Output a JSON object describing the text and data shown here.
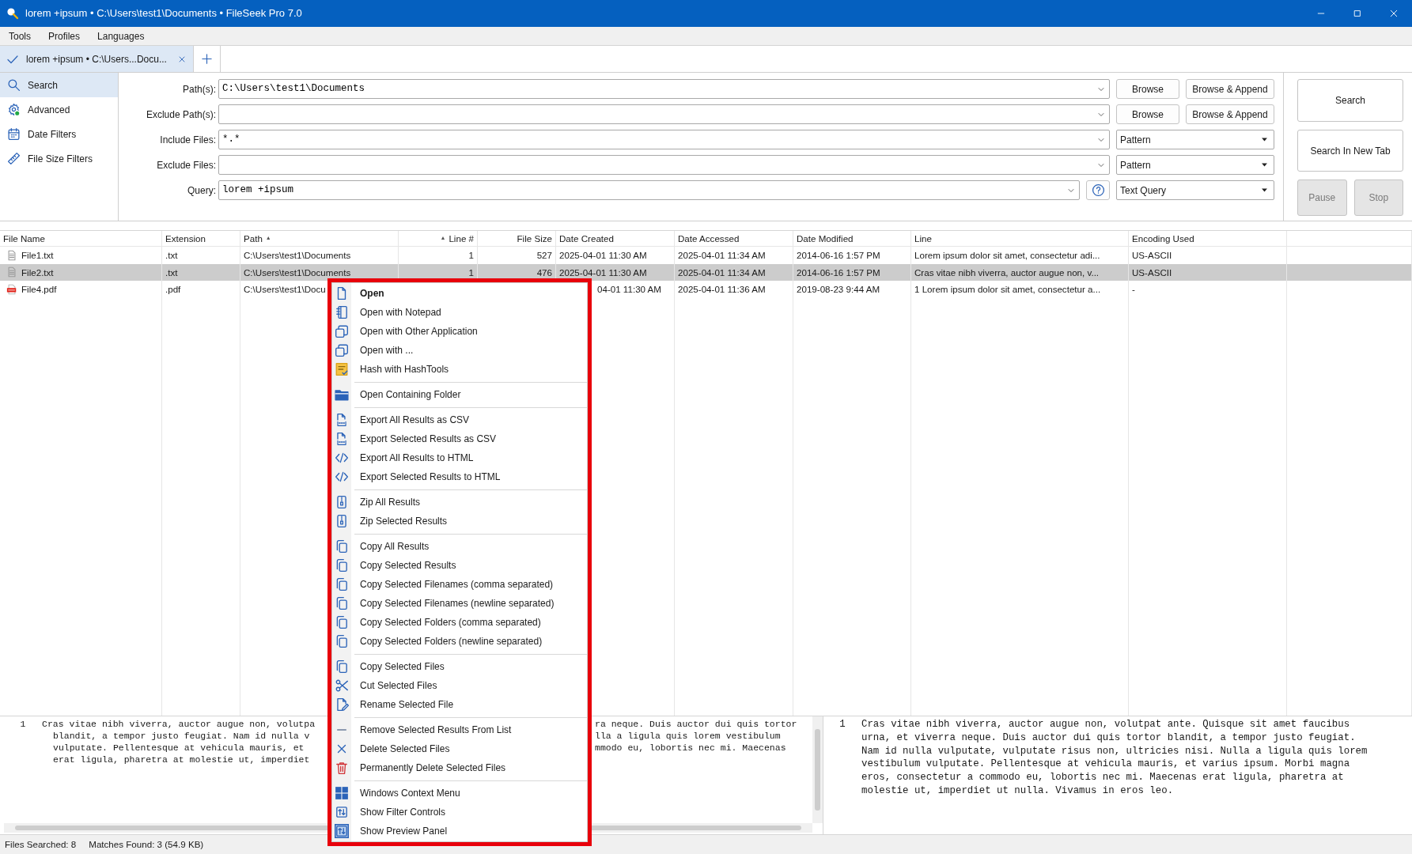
{
  "window": {
    "title": "lorem +ipsum • C:\\Users\\test1\\Documents • FileSeek Pro 7.0"
  },
  "menu_bar": [
    "Tools",
    "Profiles",
    "Languages"
  ],
  "tabs": [
    {
      "label": "lorem +ipsum • C:\\Users...Docu...",
      "selected": true
    }
  ],
  "sidebar": {
    "items": [
      {
        "label": "Search",
        "selected": true
      },
      {
        "label": "Advanced",
        "selected": false
      },
      {
        "label": "Date Filters",
        "selected": false
      },
      {
        "label": "File Size Filters",
        "selected": false
      }
    ]
  },
  "search_form": {
    "fields": [
      {
        "label": "Path(s):",
        "kind": "browse",
        "value": "C:\\Users\\test1\\Documents",
        "buttons": [
          "Browse",
          "Browse & Append"
        ]
      },
      {
        "label": "Exclude Path(s):",
        "kind": "browse",
        "buttons": [
          "Browse",
          "Browse & Append"
        ]
      },
      {
        "label": "Include Files:",
        "kind": "select",
        "value": "*.*",
        "option": "Pattern"
      },
      {
        "label": "Exclude Files:",
        "kind": "select",
        "option": "Pattern"
      },
      {
        "label": "Query:",
        "kind": "query",
        "value": "lorem +ipsum",
        "option": "Text Query"
      }
    ],
    "actions": [
      {
        "label": "Search",
        "disabled": false
      },
      {
        "label": "Search In New Tab",
        "disabled": false
      },
      {
        "label": "Pause",
        "disabled": true
      },
      {
        "label": "Stop",
        "disabled": true
      }
    ]
  },
  "results": {
    "columns": [
      {
        "label": "File Name"
      },
      {
        "label": "Extension"
      },
      {
        "label": "Path",
        "sort_mark": "▲"
      },
      {
        "label": "Line #",
        "sort_mark": "▲"
      },
      {
        "label": "File Size"
      },
      {
        "label": "Date Created"
      },
      {
        "label": "Date Accessed"
      },
      {
        "label": "Date Modified"
      },
      {
        "label": "Line"
      },
      {
        "label": "Encoding Used"
      }
    ],
    "rows": [
      {
        "kind": "text",
        "selected": false,
        "covered": false,
        "cells": [
          "File1.txt",
          ".txt",
          "C:\\Users\\test1\\Documents",
          "1",
          "527",
          "2025-04-01 11:30 AM",
          "2025-04-01 11:34 AM",
          "2014-06-16 1:57 PM",
          "Lorem ipsum dolor sit amet, consectetur adi...",
          "US-ASCII"
        ]
      },
      {
        "kind": "text",
        "selected": true,
        "covered": false,
        "cells": [
          "File2.txt",
          ".txt",
          "C:\\Users\\test1\\Documents",
          "1",
          "476",
          "2025-04-01 11:30 AM",
          "2025-04-01 11:34 AM",
          "2014-06-16 1:57 PM",
          "Cras vitae nibh viverra, auctor augue non, v...",
          "US-ASCII"
        ]
      },
      {
        "kind": "pdf",
        "selected": false,
        "covered": true,
        "cells": [
          "File4.pdf",
          ".pdf",
          "C:\\Users\\test1\\Docu",
          null,
          null,
          "04-01 11:30 AM",
          "2025-04-01 11:36 AM",
          "2019-08-23 9:44 AM",
          "1 Lorem ipsum dolor sit amet, consectetur a...",
          "-"
        ]
      }
    ]
  },
  "context_menu": {
    "groups": [
      [
        {
          "label": "Open",
          "default": true,
          "checked": false
        },
        {
          "label": "Open with Notepad",
          "default": false,
          "checked": false
        },
        {
          "label": "Open with Other Application",
          "default": false,
          "checked": false
        },
        {
          "label": "Open with ...",
          "default": false,
          "checked": false
        },
        {
          "label": "Hash with HashTools",
          "default": false,
          "checked": false
        }
      ],
      [
        {
          "label": "Open Containing Folder",
          "default": false,
          "checked": false
        }
      ],
      [
        {
          "label": "Export All Results as CSV",
          "default": false,
          "checked": false
        },
        {
          "label": "Export Selected Results as CSV",
          "default": false,
          "checked": false
        },
        {
          "label": "Export All Results to HTML",
          "default": false,
          "checked": false
        },
        {
          "label": "Export Selected Results to HTML",
          "default": false,
          "checked": false
        }
      ],
      [
        {
          "label": "Zip All Results",
          "default": false,
          "checked": false
        },
        {
          "label": "Zip Selected Results",
          "default": false,
          "checked": false
        }
      ],
      [
        {
          "label": "Copy All Results",
          "default": false,
          "checked": false
        },
        {
          "label": "Copy Selected Results",
          "default": false,
          "checked": false
        },
        {
          "label": "Copy Selected Filenames (comma separated)",
          "default": false,
          "checked": false
        },
        {
          "label": "Copy Selected Filenames (newline separated)",
          "default": false,
          "checked": false
        },
        {
          "label": "Copy Selected Folders (comma separated)",
          "default": false,
          "checked": false
        },
        {
          "label": "Copy Selected Folders (newline separated)",
          "default": false,
          "checked": false
        }
      ],
      [
        {
          "label": "Copy Selected Files",
          "default": false,
          "checked": false
        },
        {
          "label": "Cut Selected Files",
          "default": false,
          "checked": false
        },
        {
          "label": "Rename Selected File",
          "default": false,
          "checked": false
        }
      ],
      [
        {
          "label": "Remove Selected Results From List",
          "default": false,
          "checked": false
        },
        {
          "label": "Delete Selected Files",
          "default": false,
          "checked": false
        },
        {
          "label": "Permanently Delete Selected Files",
          "default": false,
          "checked": false
        }
      ],
      [
        {
          "label": "Windows Context Menu",
          "default": false,
          "checked": false
        },
        {
          "label": "Show Filter Controls",
          "default": false,
          "checked": false
        },
        {
          "label": "Show Preview Panel",
          "default": false,
          "checked": true
        }
      ]
    ]
  },
  "preview_left": {
    "lines": [
      {
        "number": "1",
        "left": "Cras vitae nibh viverra, auctor augue non, volutpa",
        "right": "ra neque. Duis auctor dui quis tortor"
      },
      {
        "left": "blandit, a tempor justo feugiat. Nam id nulla v",
        "right": "lla a ligula quis lorem vestibulum"
      },
      {
        "left": "vulputate. Pellentesque at vehicula mauris, et",
        "right": "mmodo eu, lobortis nec mi. Maecenas"
      },
      {
        "left": "erat ligula, pharetra at molestie ut, imperdiet"
      }
    ]
  },
  "preview_right": {
    "number": "1",
    "lines": [
      "Cras vitae nibh viverra, auctor augue non, volutpat ante. Quisque sit amet faucibus",
      "urna, et viverra neque. Duis auctor dui quis tortor blandit, a tempor justo feugiat.",
      "Nam id nulla vulputate, vulputate risus non, ultricies nisi. Nulla a ligula quis lorem",
      "vestibulum vulputate. Pellentesque at vehicula mauris, et varius ipsum. Morbi magna",
      "eros, consectetur a commodo eu, lobortis nec mi. Maecenas erat ligula, pharetra at",
      "molestie ut, imperdiet ut nulla. Vivamus in eros leo."
    ]
  },
  "status_bar": [
    "Files Searched: 8",
    "Matches Found: 3 (54.9 KB)"
  ]
}
